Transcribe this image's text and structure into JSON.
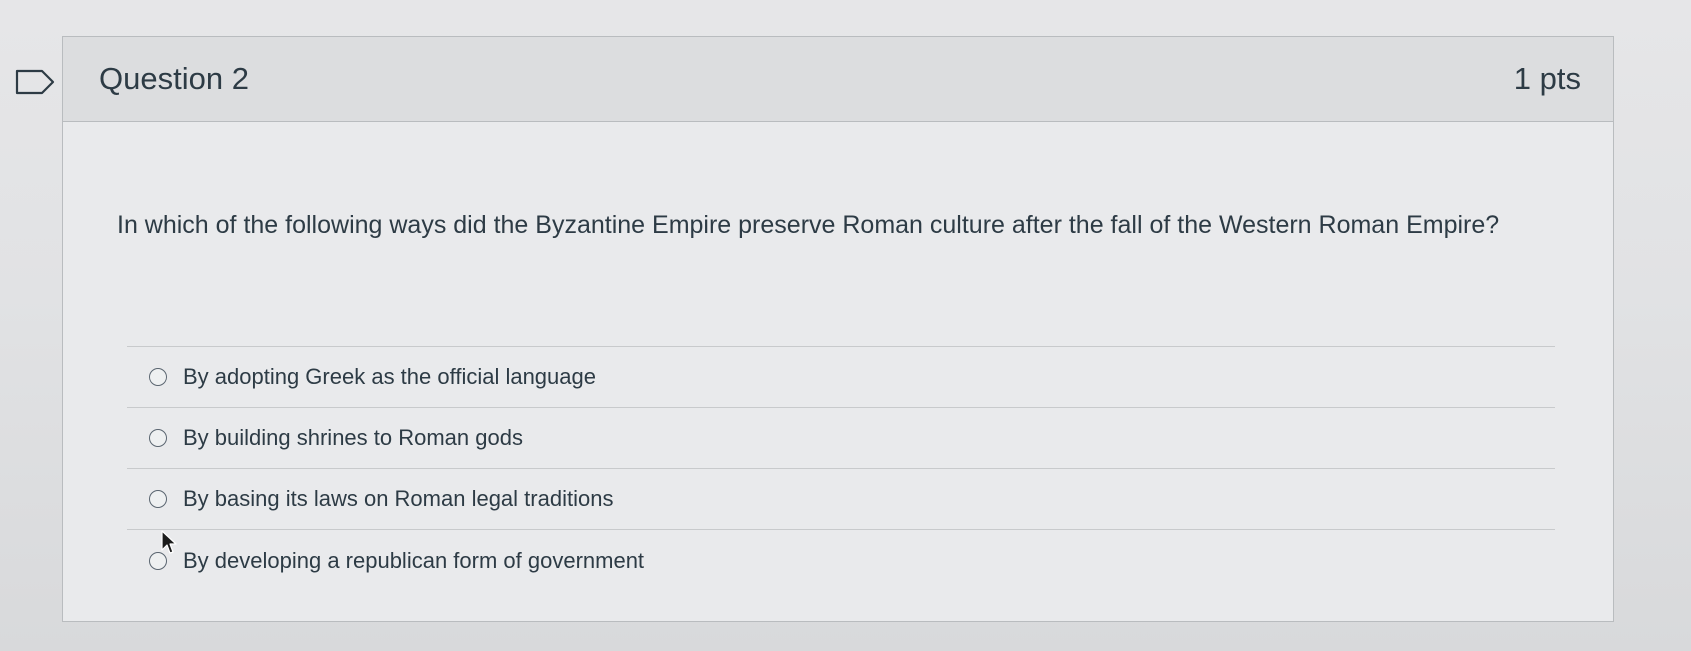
{
  "question": {
    "title": "Question 2",
    "points": "1 pts",
    "text": "In which of the following ways did the Byzantine Empire preserve Roman culture after the fall of the Western Roman Empire?",
    "answers": [
      {
        "label": "By adopting Greek as the official language"
      },
      {
        "label": "By building shrines to Roman gods"
      },
      {
        "label": "By basing its laws on Roman legal traditions"
      },
      {
        "label": "By developing a republican form of government"
      }
    ]
  },
  "icons": {
    "flag": "flag-icon",
    "cursor": "mouse-pointer-icon"
  }
}
